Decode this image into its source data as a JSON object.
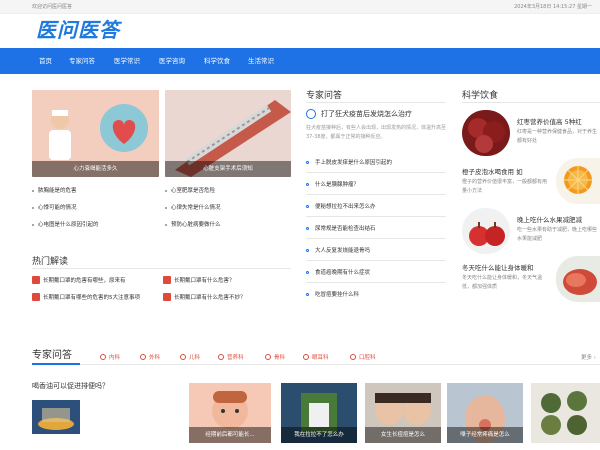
{
  "topbar": {
    "left_text": "欢迎访问医问医答",
    "right_text": "2024年3月18日 14:15:27 星期一"
  },
  "logo": {
    "text": "医问医答"
  },
  "nav": {
    "items": [
      "首页",
      "专家问答",
      "医学常识",
      "医学咨询",
      "科学饮食",
      "生活常识"
    ]
  },
  "featured": [
    {
      "caption": "心力衰竭能活多久"
    },
    {
      "caption": "心脏支架手术后须知"
    }
  ],
  "left_list": [
    "脓胸能是的危害",
    "心悸可能的情况",
    "心电图是什么原因引起的",
    "心室肥厚是否危险",
    "心律失常是什么情况",
    "预防心脏病要做什么"
  ],
  "hot": {
    "title": "热门解读",
    "items": [
      "长期戴口罩的危害有哪些，原来有",
      "长期戴口罩有什么危害？",
      "长期戴口罩有哪些的危害的5大注意事项",
      "长期戴口罩有什么危害不妙？"
    ]
  },
  "expert": {
    "title": "专家问答",
    "lead": {
      "title": "打了狂犬疫苗后发烧怎么治疗",
      "desc": "狂犬疫苗接种后，有些人会出现，出现发热的情况，体温升高至37-38度，都属于正常的接种反应。"
    },
    "items": [
      "手上脱皮发痒是什么原因引起的",
      "什么是胰腺肿瘤？",
      "便秘想拉拉不出来怎么办",
      "尿常规是否能检查出结石",
      "大人反复发烧能退骨吗",
      "食道癌晚期有什么症状",
      "吃冒痘要挂什么科"
    ]
  },
  "diet": {
    "title": "科学饮食",
    "items": [
      {
        "title": "红枣营养价值高 5种红",
        "desc": "红枣是一种营养保健食品，对于养生都有好处"
      },
      {
        "title": "橙子皮泡水喝食用 如",
        "desc": "橙子的营养价值很丰富，一般都都有用量小方法"
      },
      {
        "title": "晚上吃什么水果减肥减",
        "desc": "吃一些水果有助于减肥，晚上吃哪些水果能减肥"
      },
      {
        "title": "冬天吃什么能让身体暖和",
        "desc": "冬天吃什么能让身体暖和，冬天气温低，都加强体质"
      }
    ]
  },
  "qa_section": {
    "title": "专家问答",
    "more": "更多 ›",
    "tabs": [
      "内科",
      "外科",
      "儿科",
      "营养科",
      "骨科",
      "眼耳科",
      "口腔科"
    ],
    "lead_question": "喝香油可以促进排便吗？",
    "thumb_captions": [
      "经期前后都可能长...",
      "我在拉拉不了怎么办",
      "女生长痘痘是怎么",
      "嗓子经常疼痛是怎么"
    ]
  },
  "colors": {
    "accent": "#1f72e5",
    "logo": "#1f7ae0",
    "red": "#e04a3a"
  }
}
